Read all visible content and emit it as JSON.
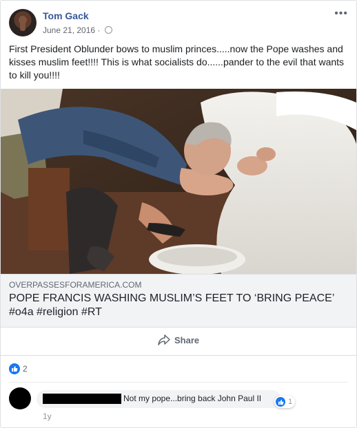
{
  "post": {
    "author": "Tom Gack",
    "date": "June 21, 2016 ·",
    "more": "•••",
    "text": "First President Oblunder bows to muslim princes.....now the Pope washes and kisses muslim feet!!!! This is what socialists do......pander to the evil that wants to kill you!!!!"
  },
  "link_preview": {
    "domain": "OVERPASSESFORAMERICA.COM",
    "title": "POPE FRANCIS WASHING MUSLIM’S FEET TO ‘BRING PEACE’ #o4a #religion #RT"
  },
  "actions": {
    "share_label": "Share"
  },
  "reactions": {
    "like_count": "2"
  },
  "comment": {
    "text": "Not my pope...bring back John Paul II",
    "reaction_count": "1",
    "time": "1y"
  },
  "colors": {
    "link_blue": "#365899",
    "like_blue": "#1877f2"
  }
}
